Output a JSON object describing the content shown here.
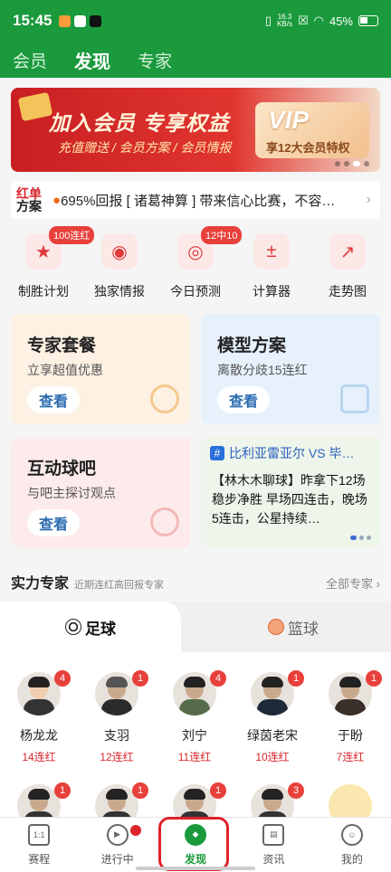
{
  "status_bar": {
    "time": "15:45",
    "net_speed_value": "16.3",
    "net_speed_unit": "KB/s",
    "battery": "45%"
  },
  "top_tabs": [
    {
      "label": "会员"
    },
    {
      "label": "发现"
    },
    {
      "label": "专家"
    }
  ],
  "banner": {
    "title": "加入会员 专享权益",
    "subtitle": "充值赠送 / 会员方案 / 会员情报",
    "vip_logo": "VIP",
    "vip_text": "享12大会员特权"
  },
  "notice": {
    "logo_line1": "红单",
    "logo_line2": "方案",
    "text": "695%回报 [ 诸葛神算 ] 带来信心比赛，不容…"
  },
  "quick_actions": [
    {
      "label": "制胜计划",
      "badge": "100连红",
      "icon": "star-flag-icon"
    },
    {
      "label": "独家情报",
      "badge": "",
      "icon": "signal-icon"
    },
    {
      "label": "今日预测",
      "badge": "12中10",
      "icon": "target-icon"
    },
    {
      "label": "计算器",
      "badge": "",
      "icon": "calculator-icon"
    },
    {
      "label": "走势图",
      "badge": "",
      "icon": "trend-chart-icon"
    }
  ],
  "cards": {
    "package": {
      "title": "专家套餐",
      "subtitle": "立享超值优惠",
      "button": "查看"
    },
    "model": {
      "title": "模型方案",
      "subtitle": "离散分歧15连红",
      "button": "查看"
    },
    "forum": {
      "title": "互动球吧",
      "subtitle": "与吧主探讨观点",
      "button": "查看"
    }
  },
  "news": {
    "tag": "比利亚雷亚尔 VS 毕…",
    "body": "【林木木聊球】昨拿下12场稳步净胜 早场四连击，晚场5连击，公星持续…"
  },
  "section": {
    "title": "实力专家",
    "subtitle": "近期连红高回报专家",
    "more": "全部专家 ›"
  },
  "sport_tabs": [
    {
      "label": "足球"
    },
    {
      "label": "篮球"
    }
  ],
  "experts_row1": [
    {
      "name": "杨龙龙",
      "streak": "14连红",
      "badge": "4"
    },
    {
      "name": "支羽",
      "streak": "12连红",
      "badge": "1"
    },
    {
      "name": "刘宁",
      "streak": "11连红",
      "badge": "4"
    },
    {
      "name": "绿茵老宋",
      "streak": "10连红",
      "badge": "1"
    },
    {
      "name": "于盼",
      "streak": "7连红",
      "badge": "1"
    }
  ],
  "experts_row2_badges": [
    "1",
    "1",
    "1",
    "3",
    ""
  ],
  "bottom_nav": [
    {
      "label": "赛程",
      "icon_text": "1:1"
    },
    {
      "label": "进行中",
      "icon_text": "▶"
    },
    {
      "label": "发现",
      "icon_text": "◆"
    },
    {
      "label": "资讯",
      "icon_text": "▤"
    },
    {
      "label": "我的",
      "icon_text": "☺"
    }
  ],
  "colors": {
    "brand_green": "#1a9a3c",
    "accent_red": "#d9252b"
  }
}
